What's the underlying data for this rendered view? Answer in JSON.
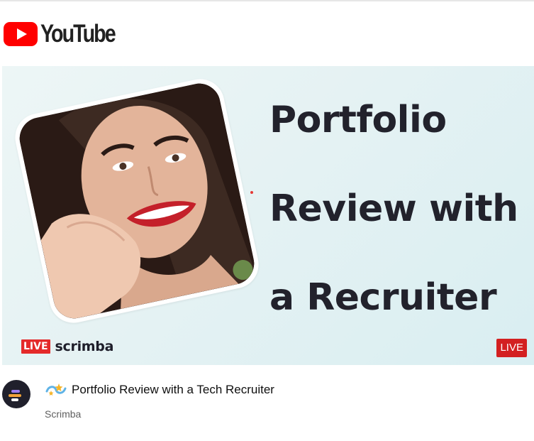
{
  "logo": {
    "text": "YouTube",
    "icon": "youtube-play-icon",
    "brand_color": "#ff0000"
  },
  "thumbnail": {
    "title_lines": [
      "Portfolio",
      "Review with",
      "a Recruiter"
    ],
    "brand_live": "LIVE",
    "brand_name": "scrimba",
    "live_badge": "LIVE",
    "live_color": "#d32021"
  },
  "video": {
    "emoji": "sparkle-emoji-icon",
    "title": "Portfolio Review with a Tech Recruiter",
    "channel": "Scrimba",
    "channel_avatar": "scrimba-avatar-icon"
  }
}
